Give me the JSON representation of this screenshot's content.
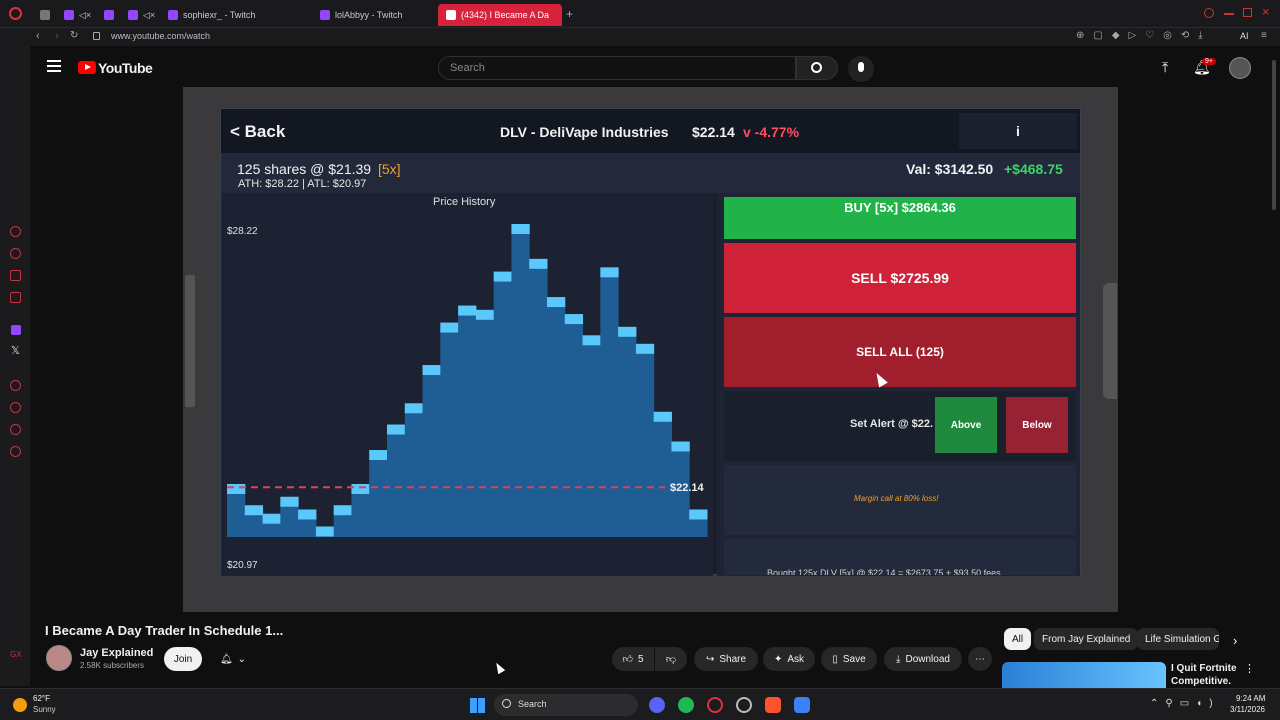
{
  "browser": {
    "tabs": [
      {
        "label": ""
      },
      {
        "label": ""
      },
      {
        "label": ""
      },
      {
        "label": ""
      },
      {
        "label": "sophiexr_ - Twitch"
      },
      {
        "label": "lolAbbyy - Twitch"
      },
      {
        "label": "(4342) I Became A Da"
      }
    ],
    "url": "www.youtube.com/watch",
    "ai_label": "AI"
  },
  "youtube": {
    "logo": "YouTube",
    "search_placeholder": "Search",
    "notif_badge": "9+",
    "video_title": "I Became A Day Trader In Schedule 1...",
    "channel_name": "Jay Explained",
    "subscribers": "2.58K subscribers",
    "join_label": "Join",
    "like_count": "5",
    "share_label": "Share",
    "ask_label": "Ask",
    "save_label": "Save",
    "download_label": "Download",
    "chips": [
      "All",
      "From Jay Explained",
      "Life Simulation G"
    ],
    "rec_title_1": "I Quit Fortnite",
    "rec_title_2": "Competitive."
  },
  "game": {
    "back_label": "< Back",
    "ticker": "DLV - DeliVape Industries",
    "price": "$22.14",
    "change": "v -4.77%",
    "info_label": "i",
    "position": "125 shares @ $21.39",
    "leverage": "[5x]",
    "ath_atl": "ATH: $28.22  |  ATL: $20.97",
    "value": "Val: $3142.50",
    "pnl": "+$468.75",
    "chart_title": "Price History",
    "high_label": "$28.22",
    "low_label": "$20.97",
    "current_label": "$22.14",
    "buy_label": "BUY [5x]  $2864.36",
    "sell_label": "SELL  $2725.99",
    "sell_all_label": "SELL ALL (125)",
    "alert_label": "Set Alert @ $22.",
    "above_label": "Above",
    "below_label": "Below",
    "margin_label": "Margin call at 80% loss!",
    "log_label": "Bought 125x DLV [5x] @ $22.14 = $2673.75 + $93.50 fees"
  },
  "chart_data": {
    "type": "area",
    "title": "Price History",
    "xlabel": "",
    "ylabel": "",
    "ylim": [
      20.97,
      28.22
    ],
    "current_price": 22.14,
    "x": [
      1,
      2,
      3,
      4,
      5,
      6,
      7,
      8,
      9,
      10,
      11,
      12,
      13,
      14,
      15,
      16,
      17,
      18,
      19,
      20,
      21,
      22,
      23,
      24,
      25
    ],
    "values": [
      22.1,
      21.6,
      21.4,
      21.8,
      21.5,
      21.1,
      21.6,
      22.1,
      22.9,
      23.5,
      24.0,
      24.9,
      25.9,
      26.3,
      26.2,
      27.1,
      28.22,
      27.4,
      26.5,
      26.1,
      25.6,
      27.2,
      25.8,
      25.4,
      23.8,
      23.1,
      21.5
    ]
  },
  "taskbar": {
    "weather_temp": "62°F",
    "weather_cond": "Sunny",
    "search_label": "Search",
    "time": "9:24 AM",
    "date": "3/11/2026"
  }
}
